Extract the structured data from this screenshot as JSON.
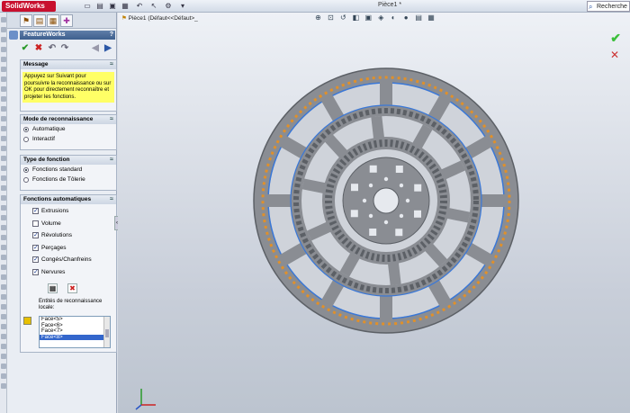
{
  "app": {
    "logo_text": "SolidWorks",
    "document_title": "Pièce1 *",
    "search_placeholder": "Recherche"
  },
  "tree": {
    "label": "Pièce1 (Défaut<<Défaut>_"
  },
  "panel": {
    "header": "FeatureWorks",
    "help": "?",
    "message_section": {
      "title": "Message",
      "text": "Appuyez sur Suivant pour poursuivre la reconnaissance ou sur OK pour directement reconnaître et projeter les fonctions."
    },
    "mode_section": {
      "title": "Mode de reconnaissance",
      "options": [
        {
          "label": "Automatique",
          "selected": true
        },
        {
          "label": "Interactif",
          "selected": false
        }
      ]
    },
    "type_section": {
      "title": "Type de fonction",
      "options": [
        {
          "label": "Fonctions standard",
          "selected": true
        },
        {
          "label": "Fonctions de Tôlerie",
          "selected": false
        }
      ]
    },
    "auto_section": {
      "title": "Fonctions automatiques",
      "checks": [
        {
          "label": "Extrusions",
          "checked": true
        },
        {
          "label": "Volume",
          "checked": false
        },
        {
          "label": "Révolutions",
          "checked": true
        },
        {
          "label": "Perçages",
          "checked": true
        },
        {
          "label": "Congés/Chanfreins",
          "checked": true
        },
        {
          "label": "Nervures",
          "checked": true
        }
      ],
      "entities_label": "Entités de reconnaissance locale:",
      "faces": [
        "Face<5>",
        "Face<6>",
        "Face<7>",
        "Face<8>"
      ],
      "selected_face_index": 3
    }
  },
  "colors": {
    "part": "#8a8d93",
    "part_dark": "#5c6066",
    "highlight_blue": "#3a78d8",
    "highlight_orange": "#e0902a",
    "message_bg": "#ffff66"
  }
}
